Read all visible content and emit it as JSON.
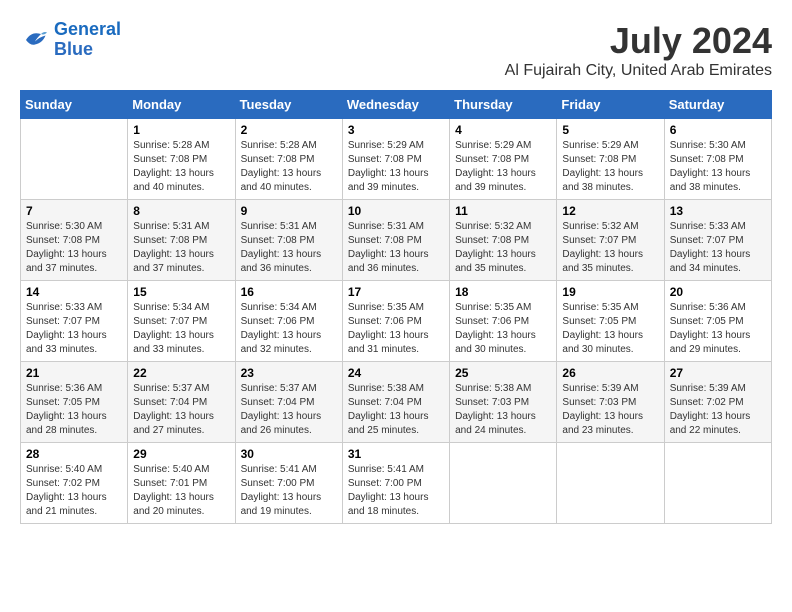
{
  "logo": {
    "line1": "General",
    "line2": "Blue"
  },
  "title": "July 2024",
  "location": "Al Fujairah City, United Arab Emirates",
  "days_header": [
    "Sunday",
    "Monday",
    "Tuesday",
    "Wednesday",
    "Thursday",
    "Friday",
    "Saturday"
  ],
  "weeks": [
    [
      {
        "num": "",
        "sunrise": "",
        "sunset": "",
        "daylight": ""
      },
      {
        "num": "1",
        "sunrise": "Sunrise: 5:28 AM",
        "sunset": "Sunset: 7:08 PM",
        "daylight": "Daylight: 13 hours and 40 minutes."
      },
      {
        "num": "2",
        "sunrise": "Sunrise: 5:28 AM",
        "sunset": "Sunset: 7:08 PM",
        "daylight": "Daylight: 13 hours and 40 minutes."
      },
      {
        "num": "3",
        "sunrise": "Sunrise: 5:29 AM",
        "sunset": "Sunset: 7:08 PM",
        "daylight": "Daylight: 13 hours and 39 minutes."
      },
      {
        "num": "4",
        "sunrise": "Sunrise: 5:29 AM",
        "sunset": "Sunset: 7:08 PM",
        "daylight": "Daylight: 13 hours and 39 minutes."
      },
      {
        "num": "5",
        "sunrise": "Sunrise: 5:29 AM",
        "sunset": "Sunset: 7:08 PM",
        "daylight": "Daylight: 13 hours and 38 minutes."
      },
      {
        "num": "6",
        "sunrise": "Sunrise: 5:30 AM",
        "sunset": "Sunset: 7:08 PM",
        "daylight": "Daylight: 13 hours and 38 minutes."
      }
    ],
    [
      {
        "num": "7",
        "sunrise": "Sunrise: 5:30 AM",
        "sunset": "Sunset: 7:08 PM",
        "daylight": "Daylight: 13 hours and 37 minutes."
      },
      {
        "num": "8",
        "sunrise": "Sunrise: 5:31 AM",
        "sunset": "Sunset: 7:08 PM",
        "daylight": "Daylight: 13 hours and 37 minutes."
      },
      {
        "num": "9",
        "sunrise": "Sunrise: 5:31 AM",
        "sunset": "Sunset: 7:08 PM",
        "daylight": "Daylight: 13 hours and 36 minutes."
      },
      {
        "num": "10",
        "sunrise": "Sunrise: 5:31 AM",
        "sunset": "Sunset: 7:08 PM",
        "daylight": "Daylight: 13 hours and 36 minutes."
      },
      {
        "num": "11",
        "sunrise": "Sunrise: 5:32 AM",
        "sunset": "Sunset: 7:08 PM",
        "daylight": "Daylight: 13 hours and 35 minutes."
      },
      {
        "num": "12",
        "sunrise": "Sunrise: 5:32 AM",
        "sunset": "Sunset: 7:07 PM",
        "daylight": "Daylight: 13 hours and 35 minutes."
      },
      {
        "num": "13",
        "sunrise": "Sunrise: 5:33 AM",
        "sunset": "Sunset: 7:07 PM",
        "daylight": "Daylight: 13 hours and 34 minutes."
      }
    ],
    [
      {
        "num": "14",
        "sunrise": "Sunrise: 5:33 AM",
        "sunset": "Sunset: 7:07 PM",
        "daylight": "Daylight: 13 hours and 33 minutes."
      },
      {
        "num": "15",
        "sunrise": "Sunrise: 5:34 AM",
        "sunset": "Sunset: 7:07 PM",
        "daylight": "Daylight: 13 hours and 33 minutes."
      },
      {
        "num": "16",
        "sunrise": "Sunrise: 5:34 AM",
        "sunset": "Sunset: 7:06 PM",
        "daylight": "Daylight: 13 hours and 32 minutes."
      },
      {
        "num": "17",
        "sunrise": "Sunrise: 5:35 AM",
        "sunset": "Sunset: 7:06 PM",
        "daylight": "Daylight: 13 hours and 31 minutes."
      },
      {
        "num": "18",
        "sunrise": "Sunrise: 5:35 AM",
        "sunset": "Sunset: 7:06 PM",
        "daylight": "Daylight: 13 hours and 30 minutes."
      },
      {
        "num": "19",
        "sunrise": "Sunrise: 5:35 AM",
        "sunset": "Sunset: 7:05 PM",
        "daylight": "Daylight: 13 hours and 30 minutes."
      },
      {
        "num": "20",
        "sunrise": "Sunrise: 5:36 AM",
        "sunset": "Sunset: 7:05 PM",
        "daylight": "Daylight: 13 hours and 29 minutes."
      }
    ],
    [
      {
        "num": "21",
        "sunrise": "Sunrise: 5:36 AM",
        "sunset": "Sunset: 7:05 PM",
        "daylight": "Daylight: 13 hours and 28 minutes."
      },
      {
        "num": "22",
        "sunrise": "Sunrise: 5:37 AM",
        "sunset": "Sunset: 7:04 PM",
        "daylight": "Daylight: 13 hours and 27 minutes."
      },
      {
        "num": "23",
        "sunrise": "Sunrise: 5:37 AM",
        "sunset": "Sunset: 7:04 PM",
        "daylight": "Daylight: 13 hours and 26 minutes."
      },
      {
        "num": "24",
        "sunrise": "Sunrise: 5:38 AM",
        "sunset": "Sunset: 7:04 PM",
        "daylight": "Daylight: 13 hours and 25 minutes."
      },
      {
        "num": "25",
        "sunrise": "Sunrise: 5:38 AM",
        "sunset": "Sunset: 7:03 PM",
        "daylight": "Daylight: 13 hours and 24 minutes."
      },
      {
        "num": "26",
        "sunrise": "Sunrise: 5:39 AM",
        "sunset": "Sunset: 7:03 PM",
        "daylight": "Daylight: 13 hours and 23 minutes."
      },
      {
        "num": "27",
        "sunrise": "Sunrise: 5:39 AM",
        "sunset": "Sunset: 7:02 PM",
        "daylight": "Daylight: 13 hours and 22 minutes."
      }
    ],
    [
      {
        "num": "28",
        "sunrise": "Sunrise: 5:40 AM",
        "sunset": "Sunset: 7:02 PM",
        "daylight": "Daylight: 13 hours and 21 minutes."
      },
      {
        "num": "29",
        "sunrise": "Sunrise: 5:40 AM",
        "sunset": "Sunset: 7:01 PM",
        "daylight": "Daylight: 13 hours and 20 minutes."
      },
      {
        "num": "30",
        "sunrise": "Sunrise: 5:41 AM",
        "sunset": "Sunset: 7:00 PM",
        "daylight": "Daylight: 13 hours and 19 minutes."
      },
      {
        "num": "31",
        "sunrise": "Sunrise: 5:41 AM",
        "sunset": "Sunset: 7:00 PM",
        "daylight": "Daylight: 13 hours and 18 minutes."
      },
      {
        "num": "",
        "sunrise": "",
        "sunset": "",
        "daylight": ""
      },
      {
        "num": "",
        "sunrise": "",
        "sunset": "",
        "daylight": ""
      },
      {
        "num": "",
        "sunrise": "",
        "sunset": "",
        "daylight": ""
      }
    ]
  ]
}
